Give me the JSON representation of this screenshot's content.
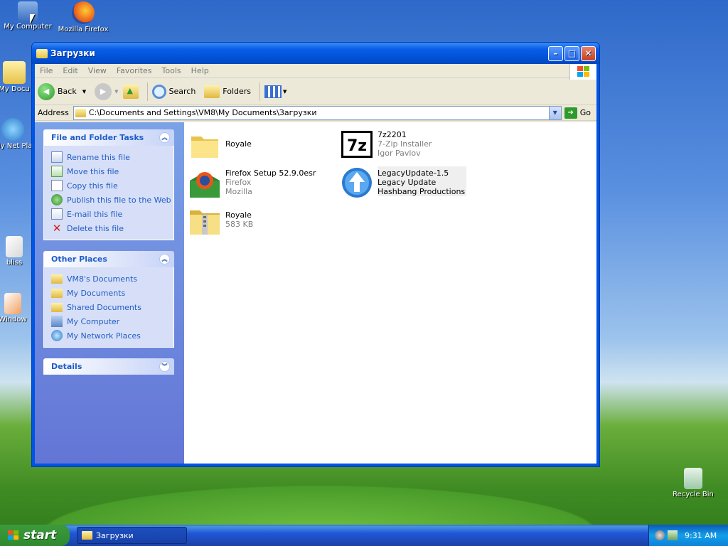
{
  "desktop": {
    "icons": [
      {
        "label": "My Computer"
      },
      {
        "label": "Mozilla Firefox"
      },
      {
        "label": "My Docu"
      },
      {
        "label": "My Net Place"
      },
      {
        "label": "bliss"
      },
      {
        "label": "Window"
      },
      {
        "label": "Recycle Bin"
      }
    ]
  },
  "window": {
    "title": "Загрузки",
    "controls": {
      "minimize": "–",
      "maximize": "□",
      "close": "✕"
    },
    "menu": [
      "File",
      "Edit",
      "View",
      "Favorites",
      "Tools",
      "Help"
    ],
    "toolbar": {
      "back": "Back",
      "search": "Search",
      "folders": "Folders"
    },
    "address": {
      "label": "Address",
      "path": "C:\\Documents and Settings\\VM8\\My Documents\\Загрузки",
      "go": "Go"
    }
  },
  "leftpane": {
    "tasks": {
      "header": "File and Folder Tasks",
      "items": [
        "Rename this file",
        "Move this file",
        "Copy this file",
        "Publish this file to the Web",
        "E-mail this file",
        "Delete this file"
      ]
    },
    "places": {
      "header": "Other Places",
      "items": [
        "VM8's Documents",
        "My Documents",
        "Shared Documents",
        "My Computer",
        "My Network Places"
      ]
    },
    "details": {
      "header": "Details"
    }
  },
  "files": [
    {
      "name": "Royale",
      "line2": "",
      "line3": "",
      "icon": "folder-icon"
    },
    {
      "name": "7z2201",
      "line2": "7-Zip Installer",
      "line3": "Igor Pavlov",
      "icon": "7zip-icon"
    },
    {
      "name": "Firefox Setup 52.9.0esr",
      "line2": "Firefox",
      "line3": "Mozilla",
      "icon": "firefox-setup-icon"
    },
    {
      "name": "LegacyUpdate-1.5",
      "line2": "Legacy Update",
      "line3": "Hashbang Productions",
      "icon": "legacy-update-icon"
    },
    {
      "name": "Royale",
      "line2": "583 KB",
      "line3": "",
      "icon": "zip-folder-icon"
    }
  ],
  "taskbar": {
    "start": "start",
    "task": "Загрузки",
    "clock": "9:31 AM"
  }
}
